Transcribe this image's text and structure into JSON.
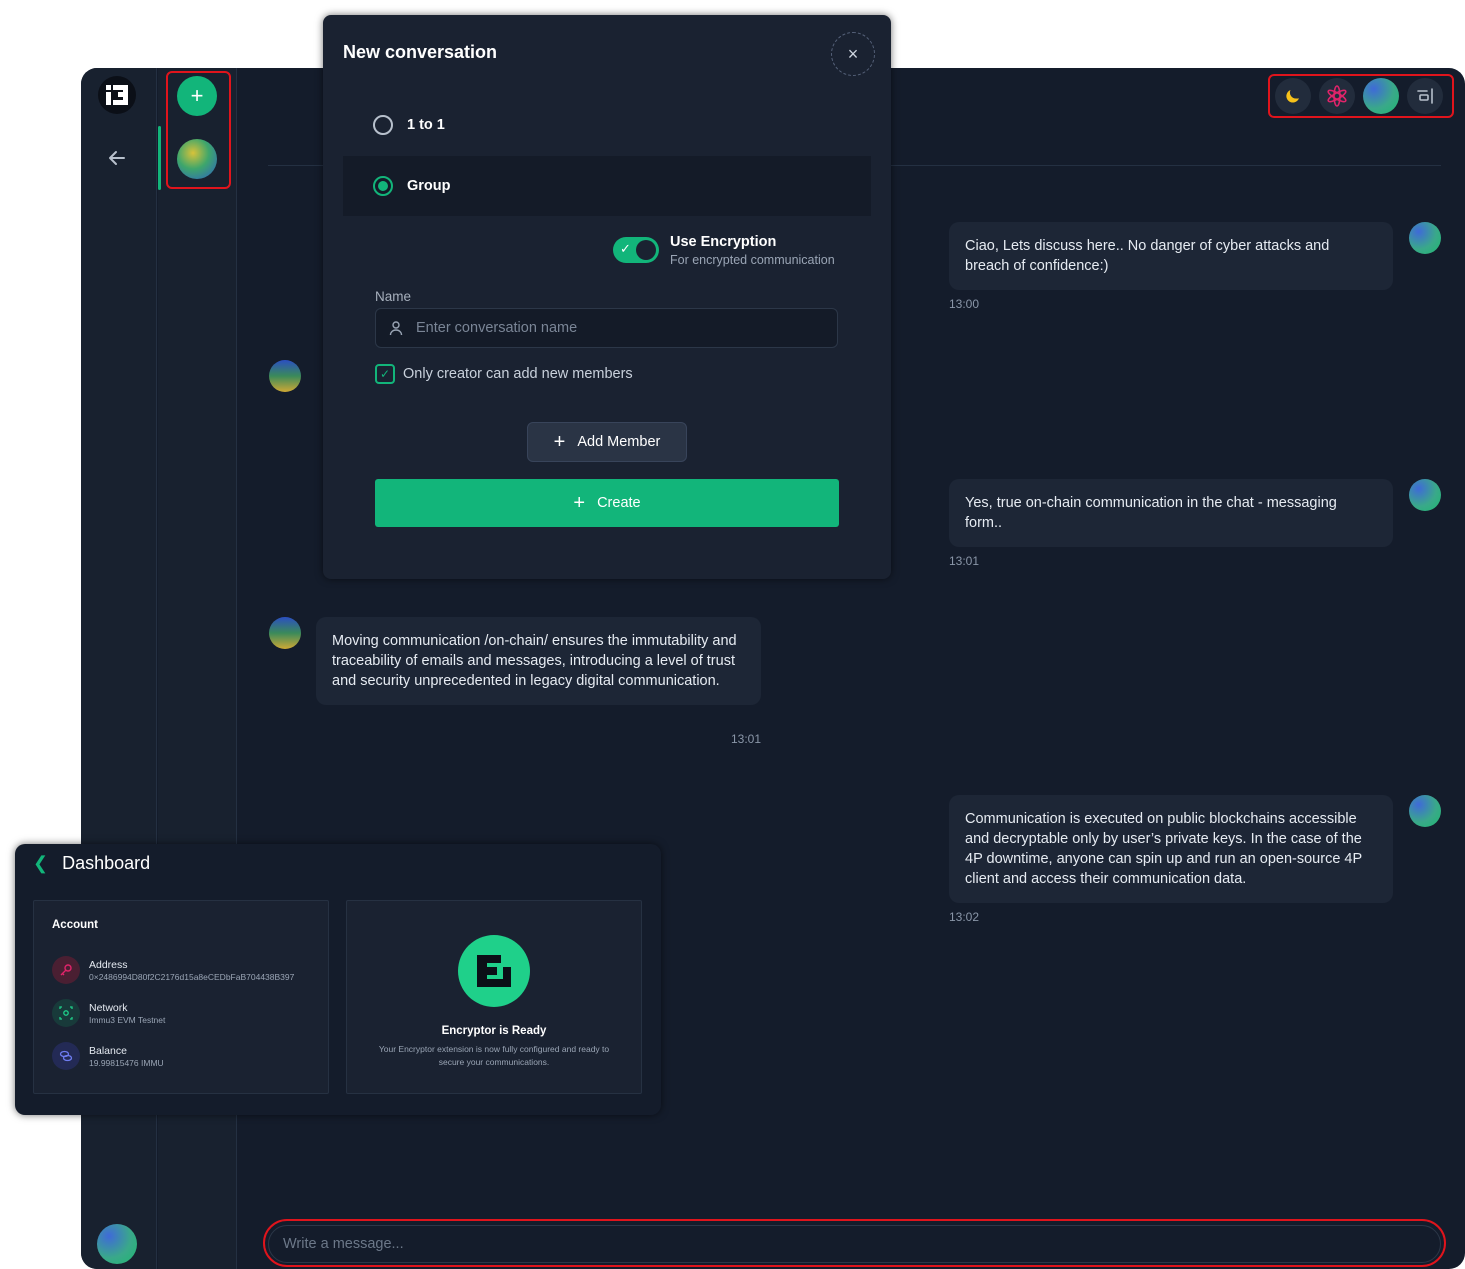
{
  "topbar": {
    "icons": [
      "moon-icon",
      "asterisk-icon",
      "avatar",
      "panel-toggle-icon"
    ]
  },
  "sidebar": {
    "new_label": "+"
  },
  "messages": [
    {
      "side": "right",
      "text": "Ciao, Lets discuss here.. No danger of cyber attacks and breach of confidence:)",
      "time": "13:00"
    },
    {
      "side": "right",
      "text": "Yes, true on-chain communication in the chat - messaging form..",
      "time": "13:01"
    },
    {
      "side": "left",
      "text": "Moving communication /on-chain/ ensures the immutability and traceability of emails and messages, introducing a level of trust and security unprecedented in legacy digital communication.",
      "time": "13:01"
    },
    {
      "side": "right",
      "text": "Communication is executed on public blockchains accessible and decryptable only by user’s private keys. In the case of the 4P downtime, anyone can spin up and run an open-source 4P client and access their communication data.",
      "time": "13:02"
    }
  ],
  "composer": {
    "placeholder": "Write a message..."
  },
  "modal": {
    "title": "New conversation",
    "close": "×",
    "options": [
      {
        "label": "1 to 1",
        "selected": false
      },
      {
        "label": "Group",
        "selected": true
      }
    ],
    "encryption": {
      "title": "Use Encryption",
      "subtitle": "For encrypted communication",
      "enabled": true
    },
    "name_label": "Name",
    "name_placeholder": "Enter conversation name",
    "only_creator_label": "Only creator can add new members",
    "only_creator_checked": true,
    "add_member_label": "Add Member",
    "create_label": "Create"
  },
  "dashboard": {
    "title": "Dashboard",
    "account": {
      "heading": "Account",
      "rows": [
        {
          "key": "Address",
          "value": "0×2486994D80f2C2176d15a8eCEDbFaB704438B397",
          "icon": "key-icon"
        },
        {
          "key": "Network",
          "value": "Immu3 EVM Testnet",
          "icon": "network-icon"
        },
        {
          "key": "Balance",
          "value": "19.99815476 IMMU",
          "icon": "coins-icon"
        }
      ]
    },
    "encryptor": {
      "title": "Encryptor is Ready",
      "description": "Your Encryptor extension is now fully configured and ready to secure your communications."
    }
  },
  "colors": {
    "accent": "#12b57a",
    "background": "#141c2b",
    "panel": "#1a2231",
    "highlight": "#e0141c"
  }
}
